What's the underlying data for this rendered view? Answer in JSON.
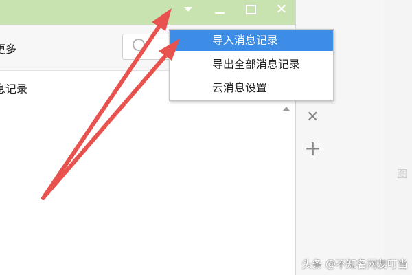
{
  "titlebar": {
    "menu_icon": "triangle-down-icon",
    "minimize_icon": "minimize-icon",
    "maximize_icon": "maximize-icon",
    "close_label": "✕"
  },
  "toolbar": {
    "more_label": "更多",
    "search_icon": "search-icon"
  },
  "list": {
    "items": [
      {
        "label": "息记录"
      }
    ]
  },
  "dropdown": {
    "items": [
      {
        "label": "导入消息记录",
        "active": true
      },
      {
        "label": "导出全部消息记录",
        "active": false
      },
      {
        "label": "云消息设置",
        "active": false
      }
    ]
  },
  "side_panel": {
    "close_label": "✕",
    "add_label": "+",
    "cut_text": "图"
  },
  "watermark": "头条 @不知名网友叮当",
  "colors": {
    "titlebar": "#c9e3b0",
    "menu_highlight": "#3d8de6",
    "annotation_arrow": "#e8524f"
  }
}
